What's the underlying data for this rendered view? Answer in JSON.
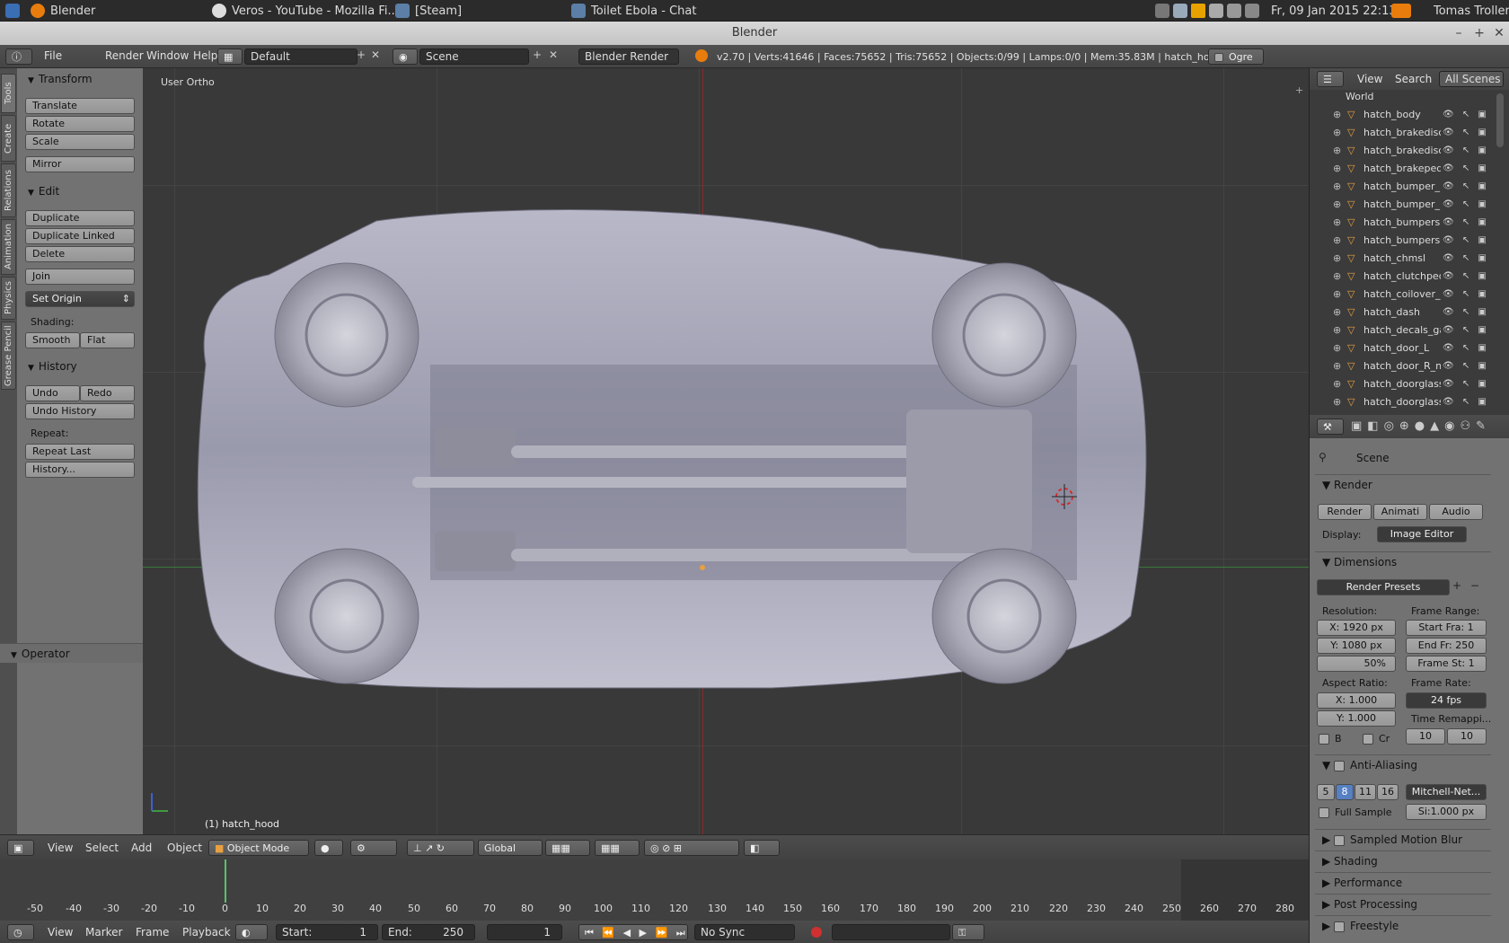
{
  "sysbar": {
    "app_menu": "Blender",
    "tasks": [
      "Veros - YouTube - Mozilla Fi...",
      "[Steam]",
      "Toilet Ebola - Chat"
    ],
    "datetime": "Fr, 09 Jan 2015 22:13",
    "user": "Tomas Troller"
  },
  "window": {
    "title": "Blender",
    "min": "–",
    "max": "+",
    "close": "✕"
  },
  "info_header": {
    "menus": [
      "File",
      "Render",
      "Window",
      "Help"
    ],
    "layout": "Default",
    "scene": "Scene",
    "engine": "Blender Render",
    "stats": "v2.70 | Verts:41646 | Faces:75652 | Tris:75652 | Objects:0/99 | Lamps:0/0 | Mem:35.83M | hatch_hood",
    "ogre": "Ogre"
  },
  "toolshelf": {
    "tabs": [
      "Tools",
      "Create",
      "Relations",
      "Animation",
      "Physics",
      "Grease Pencil"
    ],
    "transform_header": "Transform",
    "transform_buttons": [
      "Translate",
      "Rotate",
      "Scale"
    ],
    "mirror": "Mirror",
    "edit_header": "Edit",
    "edit_buttons": [
      "Duplicate",
      "Duplicate Linked",
      "Delete"
    ],
    "join": "Join",
    "set_origin": "Set Origin",
    "shading_label": "Shading:",
    "smooth": "Smooth",
    "flat": "Flat",
    "history_header": "History",
    "undo": "Undo",
    "redo": "Redo",
    "undo_history": "Undo History",
    "repeat_label": "Repeat:",
    "repeat_last": "Repeat Last",
    "history_btn": "History...",
    "operator_header": "Operator"
  },
  "viewport": {
    "view_label": "User Ortho",
    "object_label": "(1) hatch_hood"
  },
  "view3d_header": {
    "menus": [
      "View",
      "Select",
      "Add",
      "Object"
    ],
    "mode": "Object Mode",
    "orientation": "Global"
  },
  "timeline": {
    "ticks": [
      "-50",
      "-40",
      "-30",
      "-20",
      "-10",
      "0",
      "10",
      "20",
      "30",
      "40",
      "50",
      "60",
      "70",
      "80",
      "90",
      "100",
      "110",
      "120",
      "130",
      "140",
      "150",
      "160",
      "170",
      "180",
      "190",
      "200",
      "210",
      "220",
      "230",
      "240",
      "250",
      "260",
      "270",
      "280"
    ],
    "current_frame_marker": 1,
    "menus": [
      "View",
      "Marker",
      "Frame",
      "Playback"
    ],
    "start_label": "Start:",
    "start_value": "1",
    "end_label": "End:",
    "end_value": "250",
    "current": "1",
    "sync": "No Sync"
  },
  "outliner": {
    "menus": [
      "View",
      "Search"
    ],
    "filter": "All Scenes",
    "world": "World",
    "items": [
      "hatch_body",
      "hatch_brakedisc_",
      "hatch_brakedisc_",
      "hatch_brakepeda",
      "hatch_bumper_F",
      "hatch_bumper_R",
      "hatch_bumpersig",
      "hatch_bumpersig",
      "hatch_chmsl",
      "hatch_clutchpeda",
      "hatch_coilover_F",
      "hatch_dash",
      "hatch_decals_ga",
      "hatch_door_L",
      "hatch_door_R_no",
      "hatch_doorglass_",
      "hatch_doorglass_"
    ]
  },
  "properties": {
    "scene": "Scene",
    "render_header": "Render",
    "render_btn": "Render",
    "anim_btn": "Animati",
    "audio_btn": "Audio",
    "display_label": "Display:",
    "display_value": "Image Editor",
    "dimensions_header": "Dimensions",
    "presets": "Render Presets",
    "resolution_label": "Resolution:",
    "res_x": "X: 1920 px",
    "res_y": "Y: 1080 px",
    "res_pct": "50%",
    "frame_range_label": "Frame Range:",
    "start_frame": "Start Fra: 1",
    "end_frame": "End Fr: 250",
    "frame_step": "Frame St: 1",
    "aspect_label": "Aspect Ratio:",
    "asp_x": "X:    1.000",
    "asp_y": "Y:    1.000",
    "frame_rate_label": "Frame Rate:",
    "fps": "24 fps",
    "time_remap_label": "Time Remappi...",
    "remap_old": "10",
    "remap_new": "10",
    "border": "B",
    "crop": "Cr",
    "aa_header": "Anti-Aliasing",
    "aa_samples": [
      "5",
      "8",
      "11",
      "16"
    ],
    "aa_filter": "Mitchell-Net...",
    "full_sample": "Full Sample",
    "filter_size": "Si:1.000 px",
    "collapsed": [
      "Sampled Motion Blur",
      "Shading",
      "Performance",
      "Post Processing",
      "Freestyle"
    ]
  }
}
